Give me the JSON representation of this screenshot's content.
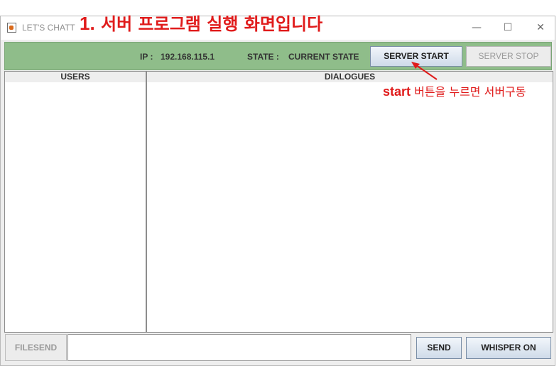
{
  "window": {
    "title": "LET'S CHATT",
    "controls": {
      "minimize": "—",
      "maximize": "☐",
      "close": "✕"
    }
  },
  "header": {
    "ip_label": "IP :",
    "ip_value": "192.168.115.1",
    "state_label": "STATE :",
    "state_value": "CURRENT STATE",
    "start_button": "SERVER START",
    "stop_button": "SERVER STOP"
  },
  "panels": {
    "users_title": "USERS",
    "dialogues_title": "DIALOGUES"
  },
  "bottom": {
    "filesend_button": "FILESEND",
    "message_value": "",
    "send_button": "SEND",
    "whisper_button": "WHISPER ON"
  },
  "annotations": {
    "title_number": "1.",
    "title_text": "서버 프로그램 실행 화면입니다",
    "note_keyword": "start",
    "note_text": "버튼을 누르면 서버구동",
    "color": "#e01b1b"
  },
  "colors": {
    "header_bg": "#8fbd8a",
    "button_gradient_top": "#f2f6fb",
    "button_gradient_bottom": "#cfdbe9"
  }
}
